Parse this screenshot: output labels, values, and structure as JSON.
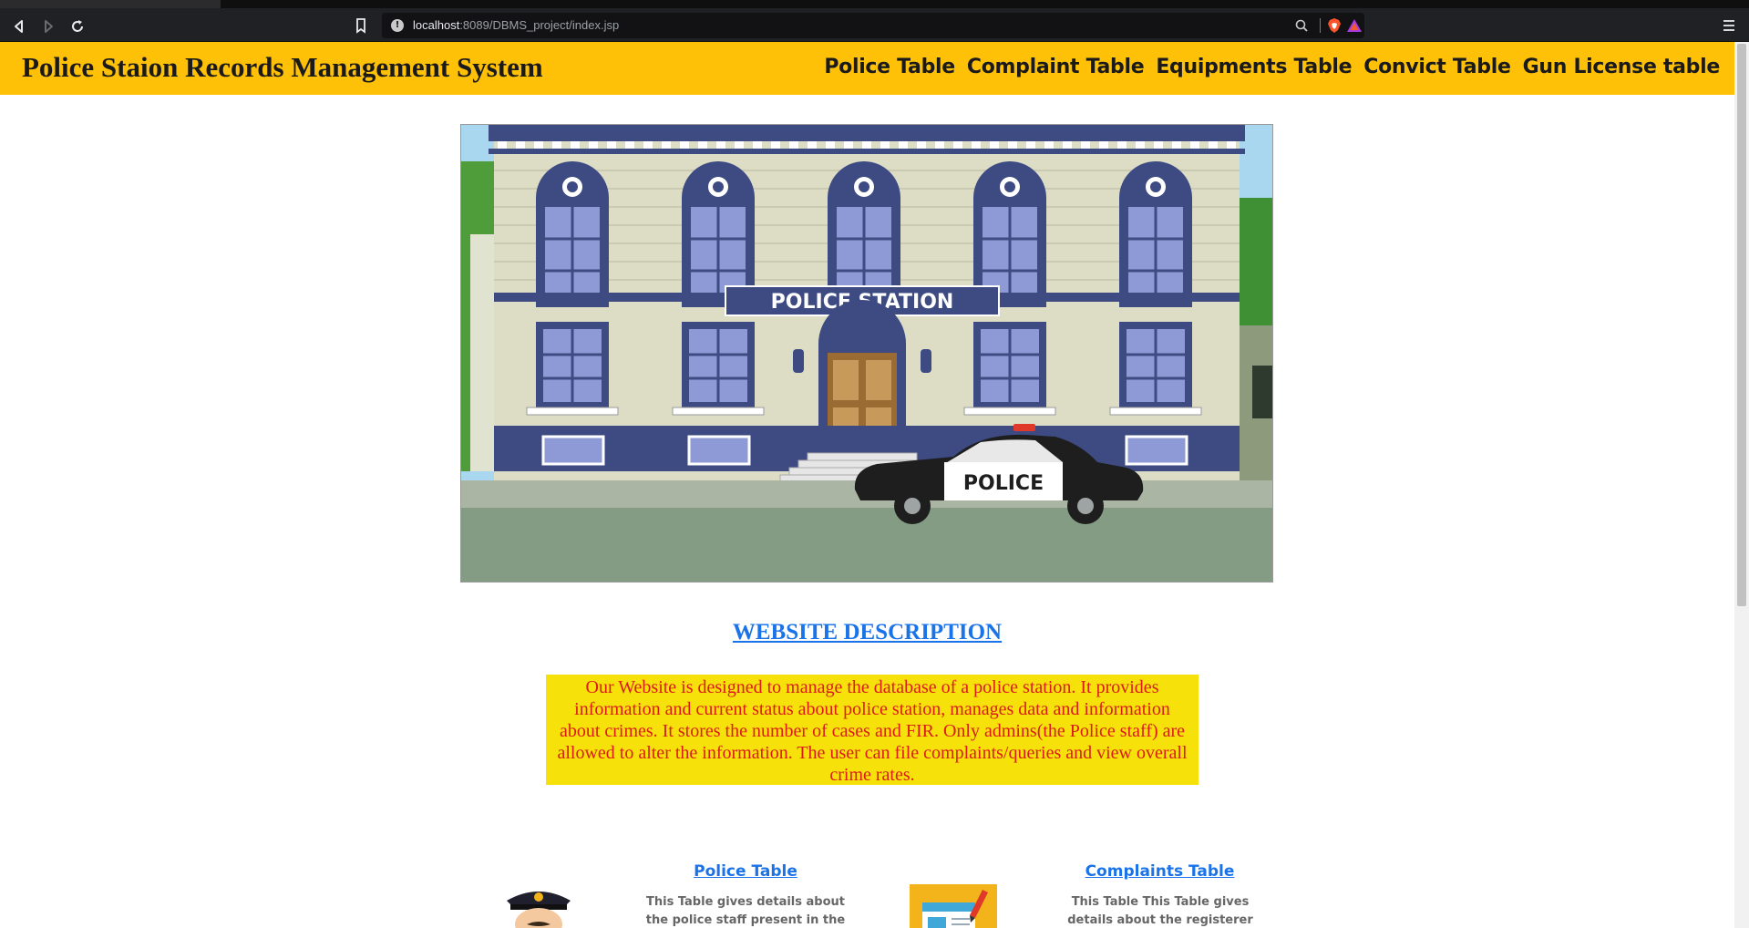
{
  "browser": {
    "url_host": "localhost",
    "url_rest": ":8089/DBMS_project/index.jsp"
  },
  "header": {
    "title": "Police Staion Records Management System",
    "nav": [
      "Police Table",
      "Complaint Table",
      "Equipments Table",
      "Convict Table",
      "Gun License table"
    ]
  },
  "hero": {
    "sign_text": "POLICE STATION",
    "car_text": "POLICE"
  },
  "description": {
    "heading": "WEBSITE DESCRIPTION",
    "text": "Our Website is designed to manage the database of a police station. It provides information and current status about police station, manages data and information about crimes. It stores the number of cases and FIR. Only admins(the Police staff) are allowed to alter the information. The user can file complaints/queries and view overall crime rates."
  },
  "cards": [
    {
      "title": "Police Table",
      "text": "This Table gives details about the police staff present in the Police"
    },
    {
      "title": "Complaints Table",
      "text": "This Table This Table gives details about the registerer giving"
    }
  ],
  "colors": {
    "header_bg": "#ffc107",
    "description_bg": "#f6e10a",
    "description_text": "#dc1b1b",
    "link": "#1a73e8"
  }
}
